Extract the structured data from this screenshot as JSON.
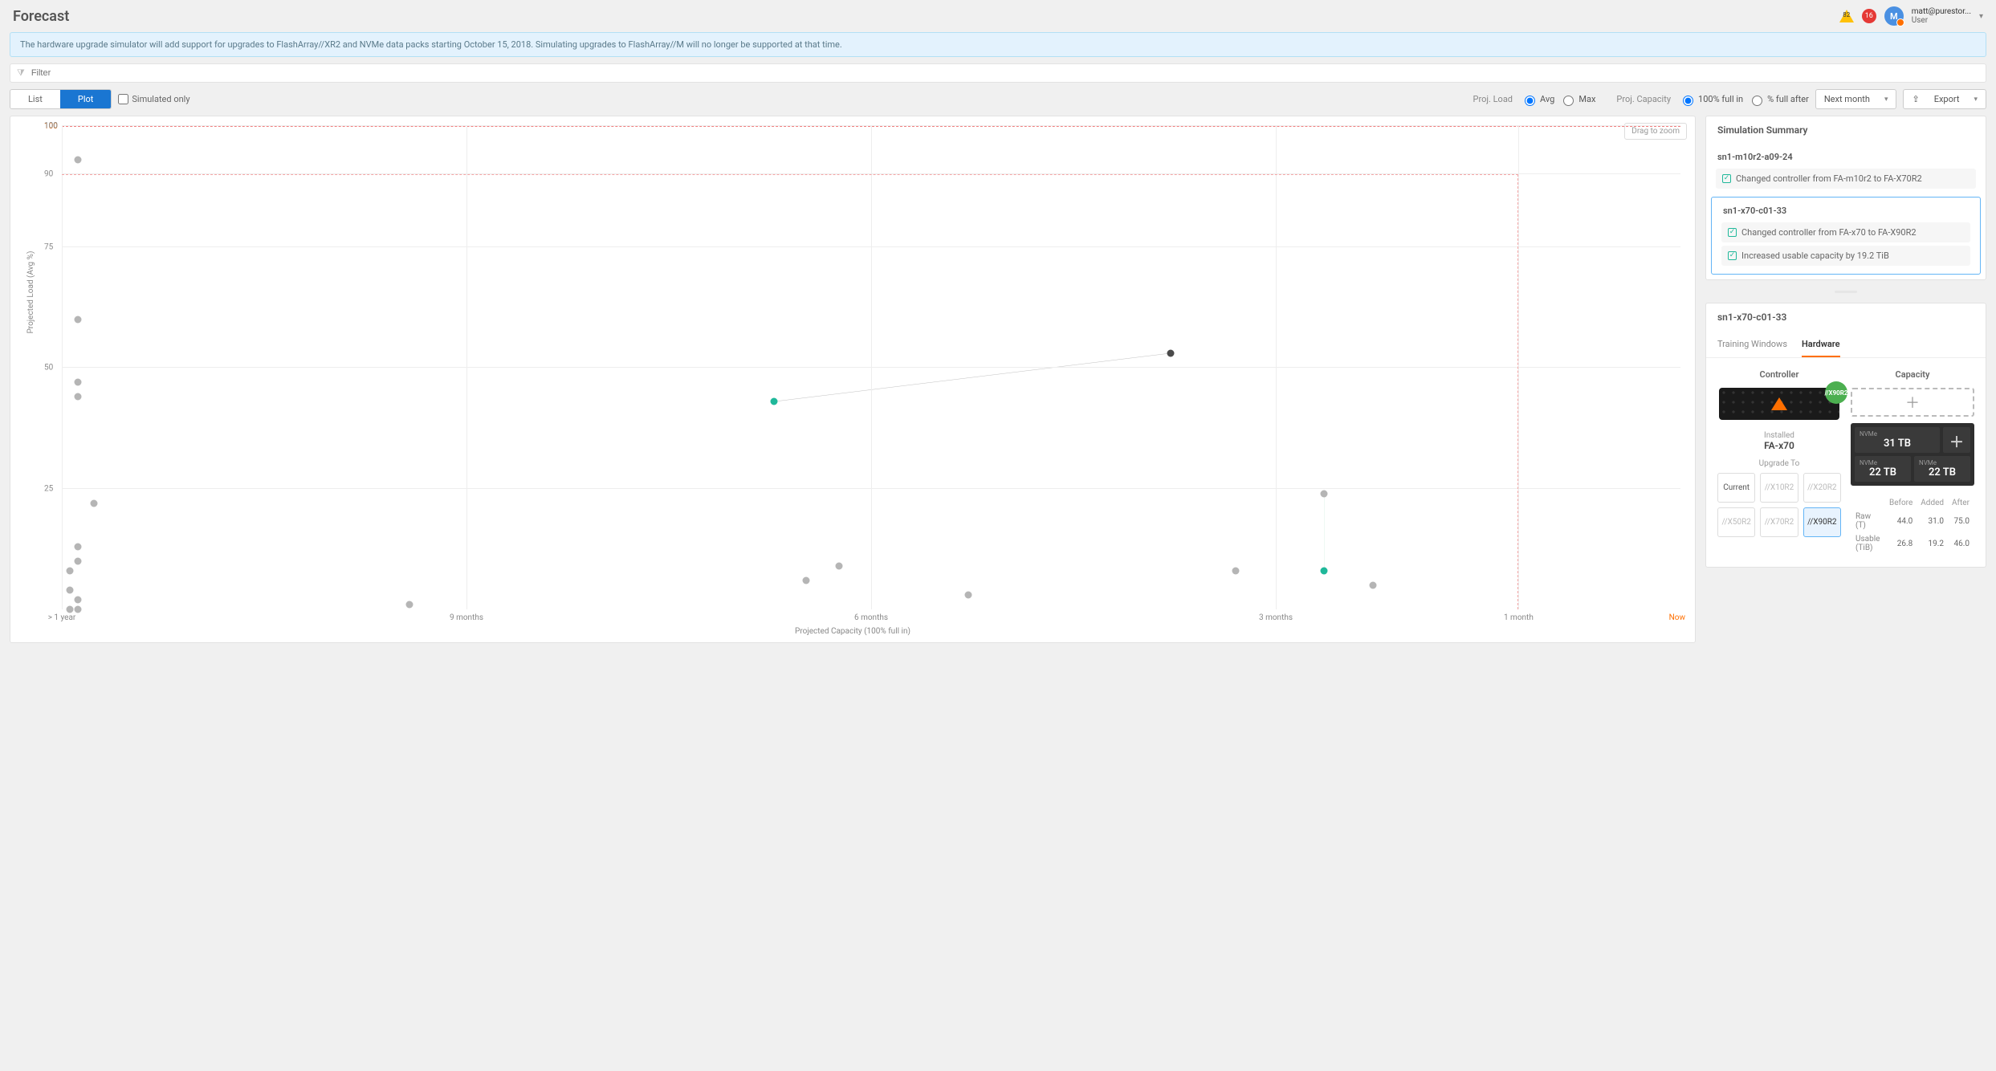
{
  "header": {
    "title": "Forecast",
    "warn_count": "82",
    "err_count": "16",
    "avatar_initial": "M",
    "user_email": "matt@purestor...",
    "user_role": "User"
  },
  "banner": "The hardware upgrade simulator will add support for upgrades to FlashArray//XR2 and NVMe data packs starting October 15, 2018. Simulating upgrades to FlashArray//M will no longer be supported at that time.",
  "filter": {
    "placeholder": "Filter"
  },
  "toolbar": {
    "list": "List",
    "plot": "Plot",
    "simulated_only": "Simulated only",
    "proj_load_label": "Proj. Load",
    "avg": "Avg",
    "max": "Max",
    "proj_cap_label": "Proj. Capacity",
    "full_in": "100% full in",
    "full_after": "% full after",
    "time_range": "Next month",
    "export": "Export"
  },
  "chart": {
    "drag_to_zoom": "Drag to zoom",
    "ylabel": "Projected Load (Avg %)",
    "xlabel": "Projected Capacity (100% full in)",
    "now": "Now"
  },
  "chart_data": {
    "type": "scatter",
    "title": "",
    "xlabel": "Projected Capacity (100% full in)",
    "ylabel": "Projected Load (Avg %)",
    "x_ticks": [
      "> 1 year",
      "9 months",
      "6 months",
      "3 months",
      "1 month"
    ],
    "y_ticks": [
      25,
      50,
      75,
      90,
      100
    ],
    "ylim": [
      0,
      100
    ],
    "points": [
      {
        "x_cat": "> 1 year",
        "x_frac": 0.01,
        "y": 93,
        "kind": "grey"
      },
      {
        "x_cat": "> 1 year",
        "x_frac": 0.01,
        "y": 60,
        "kind": "grey"
      },
      {
        "x_cat": "> 1 year",
        "x_frac": 0.01,
        "y": 47,
        "kind": "grey"
      },
      {
        "x_cat": "> 1 year",
        "x_frac": 0.01,
        "y": 44,
        "kind": "grey"
      },
      {
        "x_cat": "> 1 year",
        "x_frac": 0.02,
        "y": 22,
        "kind": "grey"
      },
      {
        "x_cat": "> 1 year",
        "x_frac": 0.01,
        "y": 13,
        "kind": "grey"
      },
      {
        "x_cat": "> 1 year",
        "x_frac": 0.01,
        "y": 10,
        "kind": "grey"
      },
      {
        "x_cat": "> 1 year",
        "x_frac": 0.005,
        "y": 8,
        "kind": "grey"
      },
      {
        "x_cat": "> 1 year",
        "x_frac": 0.005,
        "y": 4,
        "kind": "grey"
      },
      {
        "x_cat": "> 1 year",
        "x_frac": 0.01,
        "y": 2,
        "kind": "grey"
      },
      {
        "x_cat": "> 1 year",
        "x_frac": 0.005,
        "y": 0,
        "kind": "grey"
      },
      {
        "x_cat": "> 1 year",
        "x_frac": 0.01,
        "y": 0,
        "kind": "grey"
      },
      {
        "x_cat": "9 months",
        "x_frac": 0.215,
        "y": 1,
        "kind": "grey"
      },
      {
        "x_cat": "6 months",
        "x_frac": 0.46,
        "y": 6,
        "kind": "grey"
      },
      {
        "x_cat": "6 months",
        "x_frac": 0.48,
        "y": 9,
        "kind": "grey"
      },
      {
        "x_cat": "6 months",
        "x_frac": 0.56,
        "y": 3,
        "kind": "grey"
      },
      {
        "x_cat": "3 months",
        "x_frac": 0.725,
        "y": 8,
        "kind": "grey"
      },
      {
        "x_cat": "3 months",
        "x_frac": 0.78,
        "y": 24,
        "kind": "grey"
      },
      {
        "x_cat": "3 months",
        "x_frac": 0.81,
        "y": 5,
        "kind": "grey"
      },
      {
        "x_cat": "6 months",
        "x_frac": 0.44,
        "y": 43,
        "kind": "teal"
      },
      {
        "x_cat": "3 months",
        "x_frac": 0.685,
        "y": 53,
        "kind": "dark"
      },
      {
        "x_cat": "3 months",
        "x_frac": 0.78,
        "y": 8,
        "kind": "teal"
      }
    ],
    "connectors": [
      {
        "from": 19,
        "to": 20,
        "color": "#808080"
      },
      {
        "from": 17,
        "to": 21,
        "color": "#b8e0d6"
      }
    ],
    "threshold_box": {
      "x_range": [
        0,
        0.9
      ],
      "y": 90
    }
  },
  "simulation_summary": {
    "title": "Simulation Summary",
    "arrays": [
      {
        "name": "sn1-m10r2-a09-24",
        "changes": [
          "Changed controller from FA-m10r2 to FA-X70R2"
        ],
        "selected": false
      },
      {
        "name": "sn1-x70-c01-33",
        "changes": [
          "Changed controller from FA-x70 to FA-X90R2",
          "Increased usable capacity by 19.2 TiB"
        ],
        "selected": true
      }
    ]
  },
  "detail": {
    "name": "sn1-x70-c01-33",
    "tabs": {
      "training": "Training Windows",
      "hardware": "Hardware"
    },
    "controller": {
      "title": "Controller",
      "badge": "//X90R2",
      "installed_label": "Installed",
      "installed": "FA-x70",
      "upgrade_label": "Upgrade To",
      "options": [
        "Current",
        "//X10R2",
        "//X20R2",
        "//X50R2",
        "//X70R2",
        "//X90R2"
      ],
      "selected": "//X90R2"
    },
    "capacity": {
      "title": "Capacity",
      "nvme": "NVMe",
      "sizes": {
        "big": "31 TB",
        "a": "22 TB",
        "b": "22 TB"
      },
      "table": {
        "cols": [
          "Before",
          "Added",
          "After"
        ],
        "rows": [
          {
            "label": "Raw (T)",
            "before": "44.0",
            "added": "31.0",
            "after": "75.0"
          },
          {
            "label": "Usable (TiB)",
            "before": "26.8",
            "added": "19.2",
            "after": "46.0"
          }
        ]
      }
    }
  }
}
